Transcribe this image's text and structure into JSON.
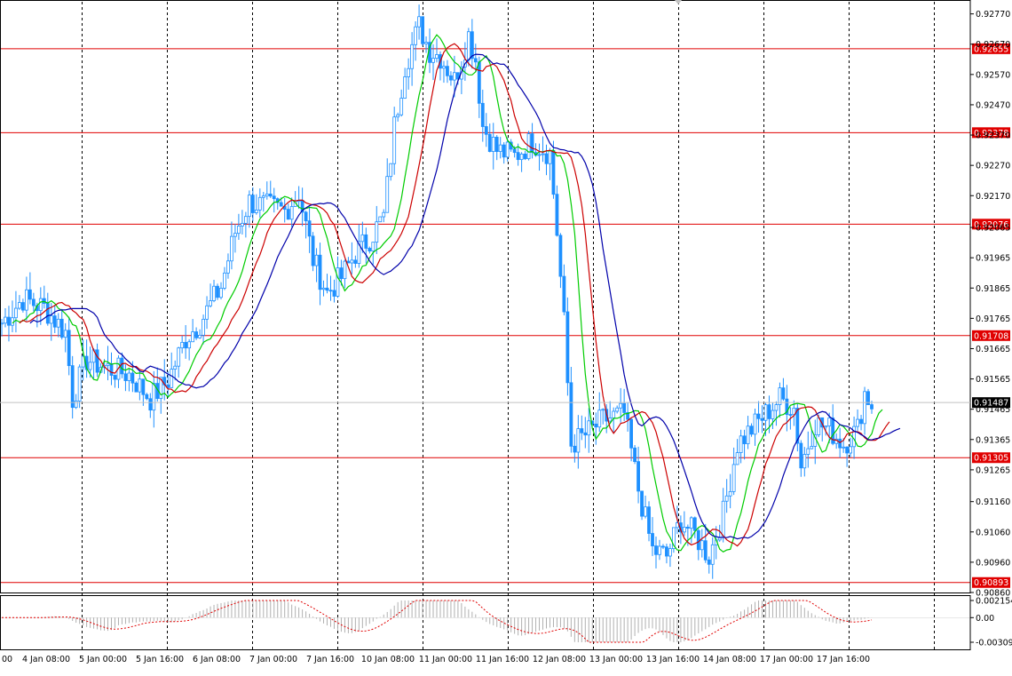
{
  "chart_data": [
    {
      "type": "candlestick",
      "symbol_panel": "main",
      "price_axis_ticks": [
        "0.92770",
        "0.92670",
        "0.92570",
        "0.92470",
        "0.92370",
        "0.92270",
        "0.92170",
        "0.92065",
        "0.91965",
        "0.91865",
        "0.91765",
        "0.91665",
        "0.91565",
        "0.91465",
        "0.91365",
        "0.91265",
        "0.91160",
        "0.91060",
        "0.90960",
        "0.90860"
      ],
      "ylim": [
        0.9086,
        0.9281
      ],
      "time_axis_labels": [
        "00",
        "4 Jan 08:00",
        "5 Jan 00:00",
        "5 Jan 16:00",
        "6 Jan 08:00",
        "7 Jan 00:00",
        "7 Jan 16:00",
        "10 Jan 08:00",
        "11 Jan 00:00",
        "11 Jan 16:00",
        "12 Jan 08:00",
        "13 Jan 00:00",
        "13 Jan 16:00",
        "14 Jan 08:00",
        "17 Jan 00:00",
        "17 Jan 16:00"
      ],
      "current_price": "0.91487",
      "current_price_value": 0.91487,
      "levels": [
        {
          "label": "0.92655",
          "value": 0.92655
        },
        {
          "label": "0.92378",
          "value": 0.92378
        },
        {
          "label": "0.92076",
          "value": 0.92076
        },
        {
          "label": "0.91708",
          "value": 0.91708
        },
        {
          "label": "0.91305",
          "value": 0.91305
        },
        {
          "label": "0.90893",
          "value": 0.90893
        }
      ],
      "price_keypoints": [
        [
          0,
          0.9175
        ],
        [
          6,
          0.9183
        ],
        [
          12,
          0.918
        ],
        [
          18,
          0.9172
        ],
        [
          20,
          0.915
        ],
        [
          24,
          0.9163
        ],
        [
          30,
          0.916
        ],
        [
          36,
          0.9158
        ],
        [
          42,
          0.915
        ],
        [
          47,
          0.9156
        ],
        [
          52,
          0.917
        ],
        [
          56,
          0.9175
        ],
        [
          62,
          0.9187
        ],
        [
          66,
          0.9205
        ],
        [
          70,
          0.9215
        ],
        [
          76,
          0.9213
        ],
        [
          80,
          0.9212
        ],
        [
          84,
          0.9218
        ],
        [
          88,
          0.9196
        ],
        [
          92,
          0.9185
        ],
        [
          96,
          0.919
        ],
        [
          100,
          0.9198
        ],
        [
          104,
          0.9203
        ],
        [
          108,
          0.921
        ],
        [
          111,
          0.924
        ],
        [
          114,
          0.926
        ],
        [
          118,
          0.9273
        ],
        [
          121,
          0.9265
        ],
        [
          124,
          0.9263
        ],
        [
          128,
          0.9255
        ],
        [
          132,
          0.927
        ],
        [
          134,
          0.9262
        ],
        [
          136,
          0.924
        ],
        [
          140,
          0.9232
        ],
        [
          145,
          0.923
        ],
        [
          150,
          0.9235
        ],
        [
          155,
          0.9231
        ],
        [
          157,
          0.9205
        ],
        [
          159,
          0.9175
        ],
        [
          161,
          0.9135
        ],
        [
          165,
          0.9138
        ],
        [
          170,
          0.9143
        ],
        [
          176,
          0.9145
        ],
        [
          180,
          0.912
        ],
        [
          184,
          0.91
        ],
        [
          188,
          0.9098
        ],
        [
          192,
          0.911
        ],
        [
          196,
          0.9105
        ],
        [
          200,
          0.9098
        ],
        [
          204,
          0.9112
        ],
        [
          208,
          0.9135
        ],
        [
          212,
          0.914
        ],
        [
          216,
          0.9145
        ],
        [
          220,
          0.915
        ],
        [
          224,
          0.9147
        ],
        [
          226,
          0.9128
        ],
        [
          230,
          0.9142
        ],
        [
          234,
          0.914
        ],
        [
          238,
          0.9135
        ],
        [
          242,
          0.914
        ],
        [
          244,
          0.9152
        ],
        [
          246,
          0.9148
        ]
      ],
      "ma_periods": [
        5,
        8,
        13
      ],
      "ma_colors": {
        "fast": "#00cc00",
        "mid": "#cc0000",
        "slow": "#0000aa"
      },
      "candle_color": "#1e90ff",
      "level_color": "#e00000",
      "grid": "vertical dashed"
    },
    {
      "type": "histogram",
      "symbol_panel": "oscillator",
      "axis_ticks": [
        "0.002154",
        "0.00",
        "-0.003096"
      ],
      "ylim": [
        -0.003096,
        0.002154
      ],
      "signal_color": "#e00000",
      "histogram_color": "#b0b0b0"
    }
  ],
  "colors": {
    "background": "#ffffff",
    "grid": "#000000",
    "current_price_tag": "#000000"
  }
}
